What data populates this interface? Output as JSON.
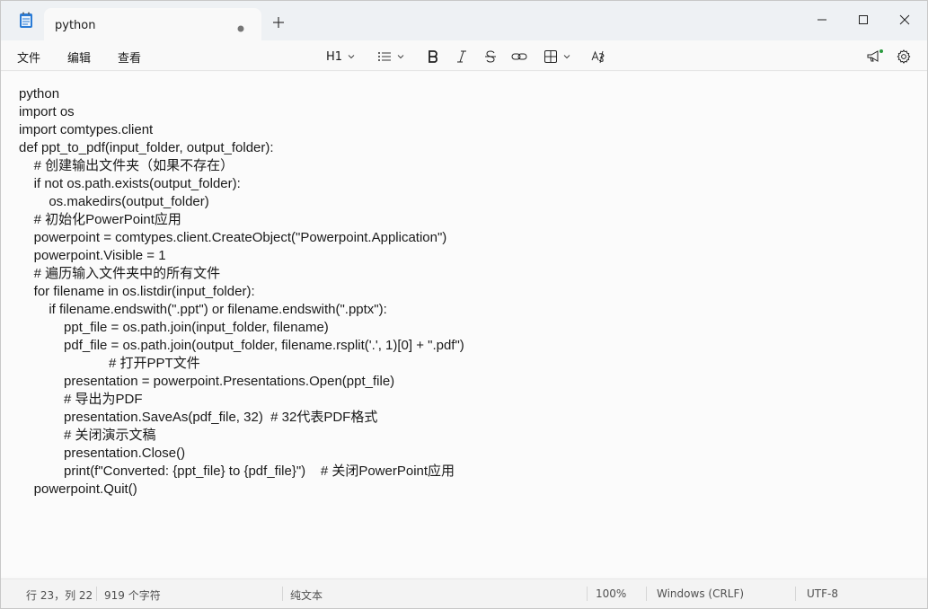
{
  "tab": {
    "title": "python"
  },
  "menu": {
    "file": "文件",
    "edit": "编辑",
    "view": "查看"
  },
  "toolbar": {
    "heading_label": "H1"
  },
  "editor": {
    "lines": [
      "python",
      "import os",
      "import comtypes.client",
      "def ppt_to_pdf(input_folder, output_folder):",
      "    # 创建输出文件夹（如果不存在）",
      "    if not os.path.exists(output_folder):",
      "        os.makedirs(output_folder)",
      "    # 初始化PowerPoint应用",
      "    powerpoint = comtypes.client.CreateObject(\"Powerpoint.Application\")",
      "    powerpoint.Visible = 1",
      "    # 遍历输入文件夹中的所有文件",
      "    for filename in os.listdir(input_folder):",
      "        if filename.endswith(\".ppt\") or filename.endswith(\".pptx\"):",
      "            ppt_file = os.path.join(input_folder, filename)",
      "            pdf_file = os.path.join(output_folder, filename.rsplit('.', 1)[0] + \".pdf\")",
      "                        # 打开PPT文件",
      "            presentation = powerpoint.Presentations.Open(ppt_file)",
      "            # 导出为PDF",
      "            presentation.SaveAs(pdf_file, 32)  # 32代表PDF格式",
      "            # 关闭演示文稿",
      "            presentation.Close()",
      "            print(f\"Converted: {ppt_file} to {pdf_file}\")    # 关闭PowerPoint应用",
      "    powerpoint.Quit()"
    ]
  },
  "status": {
    "position": "行 23，列 22",
    "chars": "919 个字符",
    "format": "纯文本",
    "zoom": "100%",
    "line_ending": "Windows (CRLF)",
    "encoding": "UTF-8"
  },
  "icons": {
    "app": "notepad-icon",
    "close_tab": "close-icon",
    "new_tab": "plus-icon",
    "list": "list-icon",
    "bold": "bold-icon",
    "italic": "italic-icon",
    "strikethrough": "strikethrough-icon",
    "link": "link-icon",
    "table": "table-icon",
    "spellcheck": "spellcheck-icon",
    "announce": "megaphone-icon",
    "settings": "gear-icon"
  },
  "colors": {
    "accent": "#1b6fc4",
    "notification_dot": "#2a9a3e"
  }
}
